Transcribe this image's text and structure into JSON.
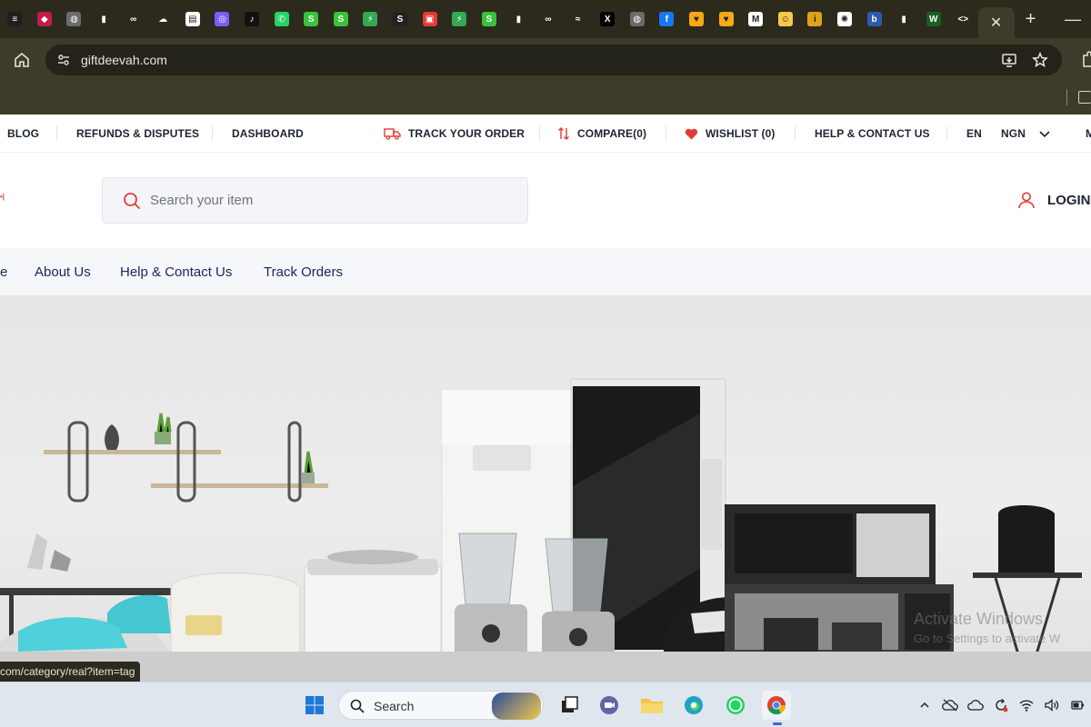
{
  "browser": {
    "url": "giftdeevah.com",
    "active_tab_close": "✕",
    "new_tab": "+",
    "minimize": "—",
    "tab_favicons": [
      {
        "icon": "music-icon",
        "color": "#1f1f1f",
        "glyph": "≡"
      },
      {
        "icon": "raspberry-icon",
        "color": "#c51a4a",
        "glyph": "◆"
      },
      {
        "icon": "globe-icon",
        "color": "#6b6b6b",
        "glyph": "◍"
      },
      {
        "icon": "audio-wave-icon",
        "color": "#2b2a1d",
        "glyph": "▮"
      },
      {
        "icon": "meta-icon",
        "color": "#2b2a1d",
        "glyph": "∞"
      },
      {
        "icon": "cloud-icon",
        "color": "#2b2a1d",
        "glyph": "☁"
      },
      {
        "icon": "newspaper-icon",
        "color": "#ffffff",
        "glyph": "▤"
      },
      {
        "icon": "spiral-icon",
        "color": "#7a5cff",
        "glyph": "◎"
      },
      {
        "icon": "tiktok-icon",
        "color": "#111111",
        "glyph": "♪"
      },
      {
        "icon": "whatsapp-icon",
        "color": "#25d366",
        "glyph": "✆"
      },
      {
        "icon": "green-s-icon",
        "color": "#3cc13b",
        "glyph": "S"
      },
      {
        "icon": "green-s-icon",
        "color": "#3cc13b",
        "glyph": "S"
      },
      {
        "icon": "green-bolt-icon",
        "color": "#34a853",
        "glyph": "⚡"
      },
      {
        "icon": "s-letter-icon",
        "color": "#222222",
        "glyph": "S"
      },
      {
        "icon": "red-box-icon",
        "color": "#e53935",
        "glyph": "▣"
      },
      {
        "icon": "green-bolt-icon",
        "color": "#34a853",
        "glyph": "⚡"
      },
      {
        "icon": "green-s-icon",
        "color": "#3cc13b",
        "glyph": "S"
      },
      {
        "icon": "audio-wave-icon",
        "color": "#2b2a1d",
        "glyph": "▮"
      },
      {
        "icon": "meta-icon",
        "color": "#2b2a1d",
        "glyph": "∞"
      },
      {
        "icon": "wave-icon",
        "color": "#2b2a1d",
        "glyph": "≈"
      },
      {
        "icon": "x-icon",
        "color": "#000000",
        "glyph": "X"
      },
      {
        "icon": "globe-icon",
        "color": "#6b6b6b",
        "glyph": "◍"
      },
      {
        "icon": "facebook-icon",
        "color": "#1877f2",
        "glyph": "f"
      },
      {
        "icon": "heart-icon",
        "color": "#f4a915",
        "glyph": "♥"
      },
      {
        "icon": "heart-icon",
        "color": "#f4a915",
        "glyph": "♥"
      },
      {
        "icon": "gmail-icon",
        "color": "#ffffff",
        "glyph": "M"
      },
      {
        "icon": "smiley-icon",
        "color": "#f7c948",
        "glyph": "☺"
      },
      {
        "icon": "candle-icon",
        "color": "#e0a21a",
        "glyph": "i"
      },
      {
        "icon": "openai-icon",
        "color": "#ffffff",
        "glyph": "✺"
      },
      {
        "icon": "b-letter-icon",
        "color": "#2c5ba9",
        "glyph": "b"
      },
      {
        "icon": "audio-wave-icon",
        "color": "#2b2a1d",
        "glyph": "▮"
      },
      {
        "icon": "wa-icon",
        "color": "#1b5e20",
        "glyph": "W"
      },
      {
        "icon": "code-icon",
        "color": "#2b2a1d",
        "glyph": "<>"
      }
    ]
  },
  "topbar": {
    "blog": "BLOG",
    "refunds": "REFUNDS & DISPUTES",
    "dashboard": "DASHBOARD",
    "track": "TRACK YOUR ORDER",
    "compare": "COMPARE(0)",
    "wishlist": "WISHLIST (0)",
    "help": "HELP & CONTACT US",
    "language": "EN",
    "currency": "NGN",
    "more": "M"
  },
  "header": {
    "logo_fragment": "•|",
    "search_placeholder": "Search your item",
    "login": "LOGIN"
  },
  "mainnav": {
    "first_fragment": "e",
    "about": "About Us",
    "help": "Help & Contact Us",
    "track": "Track Orders"
  },
  "hero": {
    "status_url": "com/category/real?item=tag",
    "activate_title": "Activate Windows",
    "activate_sub": "Go to Settings to activate W"
  },
  "taskbar": {
    "search_label": "Search"
  },
  "colors": {
    "accent_red": "#e53935",
    "nav_text": "#1d2760",
    "chrome_dark": "#2b2a1d",
    "chrome_mid": "#3d3b29"
  }
}
